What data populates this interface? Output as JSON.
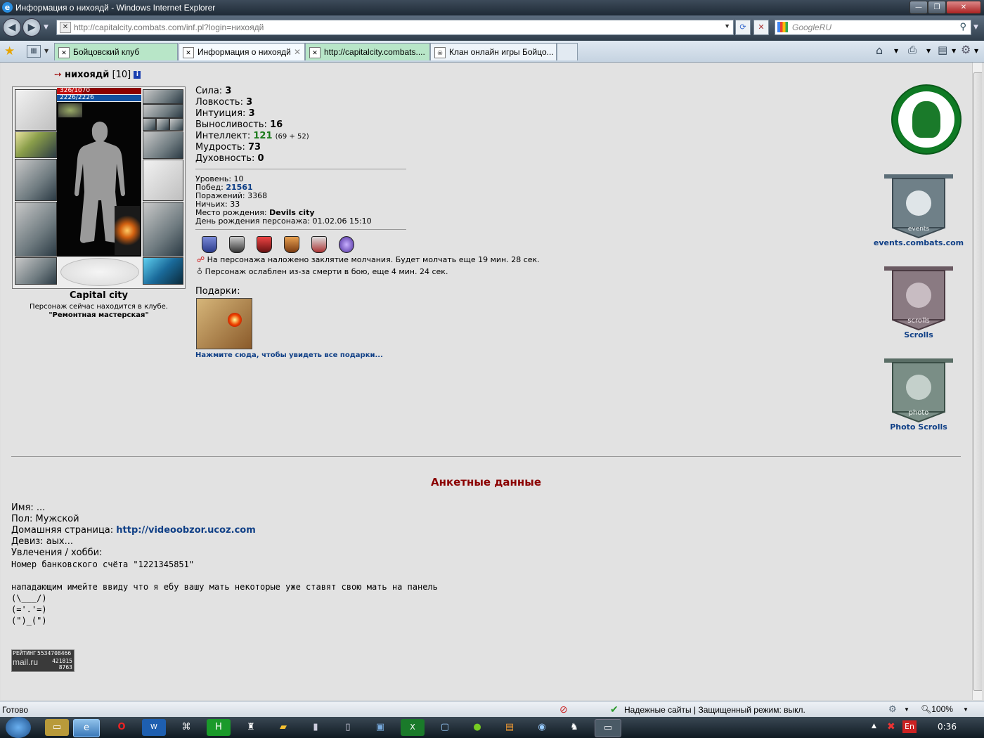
{
  "window": {
    "title": "Информация о нихоядй - Windows Internet Explorer",
    "buttons": [
      "—",
      "❐",
      "✕"
    ]
  },
  "address": {
    "url": "http://capitalcity.combats.com/inf.pl?login=нихоядй",
    "search_placeholder": "GoogleRU"
  },
  "tabs": [
    {
      "label": "Бойцовский клуб",
      "active": false
    },
    {
      "label": "Информация о нихоядй",
      "active": true
    },
    {
      "label": "http://capitalcity.combats....",
      "active": false
    },
    {
      "label": "Клан онлайн игры Бойцо...",
      "active": false
    }
  ],
  "character": {
    "name": "нихоядй",
    "level": "[10]",
    "hp": "326/1070",
    "mana": "2226/2226",
    "city": "Capital city",
    "location_line": "Персонаж сейчас находится в клубе.",
    "location": "\"Ремонтная мастерская\""
  },
  "stats": [
    {
      "label": "Сила:",
      "value": "3"
    },
    {
      "label": "Ловкость:",
      "value": "3"
    },
    {
      "label": "Интуиция:",
      "value": "3"
    },
    {
      "label": "Выносливость:",
      "value": "16"
    },
    {
      "label": "Интеллект:",
      "value": "121",
      "extra": "(69 + 52)"
    },
    {
      "label": "Мудрость:",
      "value": "73"
    },
    {
      "label": "Духовность:",
      "value": "0"
    }
  ],
  "info": {
    "level_label": "Уровень:",
    "level": "10",
    "wins_label": "Побед:",
    "wins": "21561",
    "losses_label": "Поражений:",
    "losses": "3368",
    "draws_label": "Ничьих:",
    "draws": "33",
    "birthplace_label": "Место рождения:",
    "birthplace": "Devils city",
    "birthday_label": "День рождения персонажа:",
    "birthday": "01.02.06 15:10"
  },
  "effects": {
    "silence": "На персонажа наложено заклятие молчания. Будет молчать еще 19 мин. 28 сек.",
    "weakened": "Персонаж ослаблен из-за смерти в бою, еще 4 мин. 24 сек."
  },
  "gifts": {
    "title": "Подарки:",
    "link": "Нажмите сюда, чтобы увидеть все подарки..."
  },
  "sidebar": [
    {
      "label": "events.combats.com",
      "emblem": "events"
    },
    {
      "label": "Scrolls",
      "emblem": "scrolls"
    },
    {
      "label": "Photo Scrolls",
      "emblem": "photo"
    }
  ],
  "profile": {
    "title": "Анкетные данные",
    "name": "Имя: ...",
    "gender": "Пол: Мужской",
    "homepage_label": "Домашняя страница:",
    "homepage": "http://videoobzor.ucoz.com",
    "motto": "Девиз: аых...",
    "hobbies": "Увлечения / хобби:",
    "bank": "Номер банковского счёта \"1221345851\"",
    "message": "нападающим имейте ввиду что я ебу вашу мать некоторые уже ставят свою мать на панель",
    "art": [
      "(\\___/)",
      "(='.'=)",
      "(\")_(\")"
    ]
  },
  "counter": {
    "top": "РЕЙТИНГ",
    "num1": "5534708466",
    "brand": "mail.ru",
    "num2": "421815",
    "num3": "8763"
  },
  "status": {
    "left": "Готово",
    "zone": "Надежные сайты | Защищенный режим: выкл.",
    "zoom": "100%"
  },
  "taskbar": {
    "lang": "En",
    "time": "0:36"
  },
  "colors": {
    "link": "#0f3f86",
    "title_red": "#8b0000",
    "green": "#1a7a1a",
    "hp_red": "#c01010",
    "mana_blue": "#1050a0"
  }
}
